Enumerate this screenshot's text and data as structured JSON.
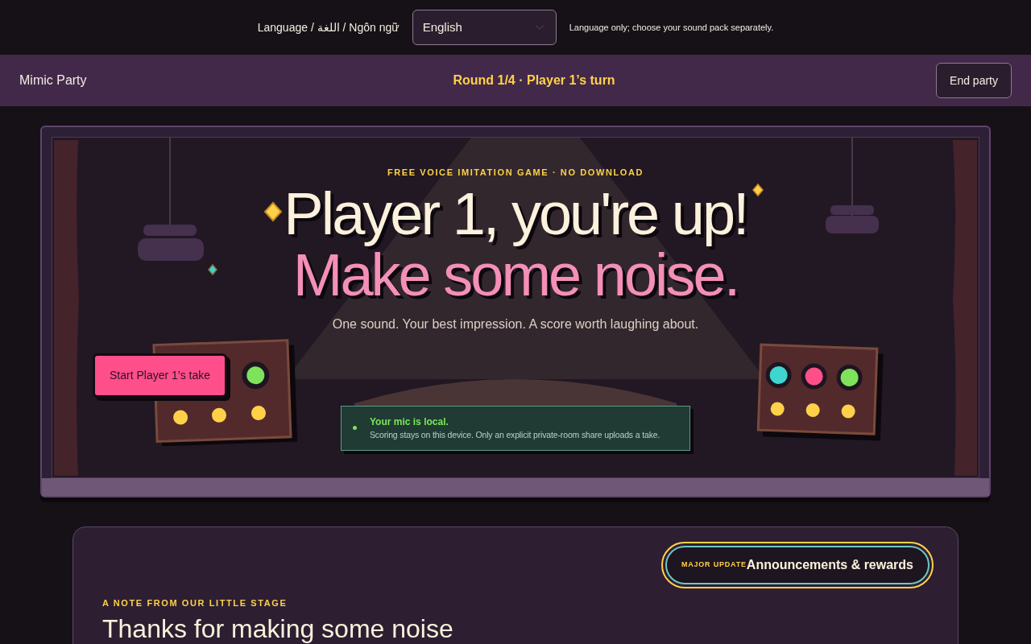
{
  "language_bar": {
    "label": "Language / اللغة / Ngôn ngữ",
    "select_value": "English",
    "note": "Language only; choose your sound pack separately."
  },
  "header": {
    "brand": "Mimic Party",
    "status": "Round 1/4 · Player 1’s turn",
    "end_button": "End party"
  },
  "hero": {
    "eyebrow": "FREE VOICE IMITATION GAME · NO DOWNLOAD",
    "title_line_1": "Player 1, you're up!",
    "title_line_2": "Make some noise.",
    "subtitle": "One sound. Your best impression. A score worth laughing about.",
    "start_button": "Start Player 1’s take",
    "privacy": {
      "title": "Your mic is local.",
      "text": "Scoring stays on this device. Only an explicit private-room share uploads a take."
    },
    "soundboard_lights": [
      {
        "color": "#3ed6cf"
      },
      {
        "color": "#ff4f8b"
      },
      {
        "color": "#7ee35a"
      }
    ]
  },
  "note_card": {
    "badge_tag": "MAJOR UPDATE",
    "badge_label": "Announcements & rewards",
    "eyebrow": "A NOTE FROM OUR LITTLE STAGE",
    "heading": "Thanks for making some noise"
  }
}
